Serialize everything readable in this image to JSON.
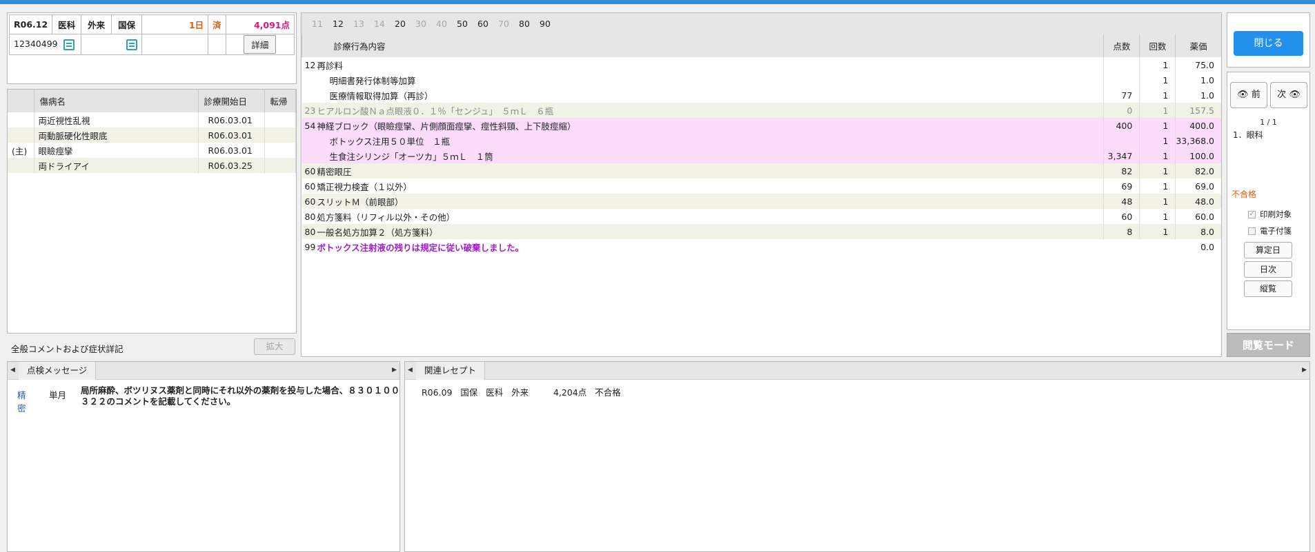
{
  "header": {
    "period": "R06.12",
    "category": "医科",
    "visit_type": "外来",
    "insurance": "国保",
    "days": "1日",
    "status": "済",
    "points": "4,091点",
    "patient_id": "12340499",
    "detail_button": "詳細"
  },
  "diseases": {
    "col_name": "傷病名",
    "col_start": "診療開始日",
    "col_outcome": "転帰",
    "rows": [
      {
        "main": "",
        "name": "両近視性乱視",
        "start": "R06.03.01"
      },
      {
        "main": "",
        "name": "両動脈硬化性眼底",
        "start": "R06.03.01"
      },
      {
        "main": "(主)",
        "name": "眼瞼痙攣",
        "start": "R06.03.01"
      },
      {
        "main": "",
        "name": "両ドライアイ",
        "start": "R06.03.25"
      }
    ]
  },
  "comment": {
    "label": "全般コメントおよび症状詳記",
    "expand_button": "拡大"
  },
  "tabs": [
    {
      "label": "11",
      "dim": true
    },
    {
      "label": "12",
      "dim": false
    },
    {
      "label": "13",
      "dim": true
    },
    {
      "label": "14",
      "dim": true
    },
    {
      "label": "20",
      "dim": false
    },
    {
      "label": "30",
      "dim": true
    },
    {
      "label": "40",
      "dim": true
    },
    {
      "label": "50",
      "dim": false
    },
    {
      "label": "60",
      "dim": false
    },
    {
      "label": "70",
      "dim": true
    },
    {
      "label": "80",
      "dim": false
    },
    {
      "label": "90",
      "dim": false
    }
  ],
  "procedures": {
    "col_name": "診療行為内容",
    "col_points": "点数",
    "col_count": "回数",
    "col_price": "薬価",
    "rows": [
      {
        "code": "12",
        "name": "再診料",
        "points": "",
        "count": "1",
        "price": "75.0",
        "style": "",
        "indent": false
      },
      {
        "code": "",
        "name": "明細書発行体制等加算",
        "points": "",
        "count": "1",
        "price": "1.0",
        "style": "",
        "indent": true
      },
      {
        "code": "",
        "name": "医療情報取得加算（再診）",
        "points": "77",
        "count": "1",
        "price": "1.0",
        "style": "",
        "indent": true
      },
      {
        "code": "23",
        "name": "ヒアルロン酸Ｎａ点眼液０．１％「センジュ」　５ｍＬ　６瓶",
        "points": "0",
        "count": "1",
        "price": "157.5",
        "style": "grey",
        "indent": false
      },
      {
        "code": "54",
        "name": "神経ブロック（眼瞼痙攣、片側顔面痙攣、痙性斜頸、上下肢痙縮）",
        "points": "400",
        "count": "1",
        "price": "400.0",
        "style": "pink",
        "indent": false
      },
      {
        "code": "",
        "name": "ボトックス注用５０単位　１瓶",
        "points": "",
        "count": "1",
        "price": "33,368.0",
        "style": "pink",
        "indent": true
      },
      {
        "code": "",
        "name": "生食注シリンジ「オーツカ」５ｍＬ　１筒",
        "points": "3,347",
        "count": "1",
        "price": "100.0",
        "style": "pink",
        "indent": true
      },
      {
        "code": "60",
        "name": "精密眼圧",
        "points": "82",
        "count": "1",
        "price": "82.0",
        "style": "alt",
        "indent": false
      },
      {
        "code": "60",
        "name": "矯正視力検査（１以外）",
        "points": "69",
        "count": "1",
        "price": "69.0",
        "style": "",
        "indent": false
      },
      {
        "code": "60",
        "name": "スリットＭ（前眼部）",
        "points": "48",
        "count": "1",
        "price": "48.0",
        "style": "alt",
        "indent": false
      },
      {
        "code": "80",
        "name": "処方箋料（リフィル以外・その他）",
        "points": "60",
        "count": "1",
        "price": "60.0",
        "style": "",
        "indent": false
      },
      {
        "code": "80",
        "name": "一般名処方加算２（処方箋料）",
        "points": "8",
        "count": "1",
        "price": "8.0",
        "style": "alt",
        "indent": false
      },
      {
        "code": "99",
        "name": "ボトックス注射液の残りは規定に従い破棄しました。",
        "points": "",
        "count": "",
        "price": "0.0",
        "style": "purple",
        "indent": false
      }
    ]
  },
  "sidebar": {
    "close_button": "閉じる",
    "prev_button": "前",
    "next_button": "次",
    "page_indicator": "1 / 1",
    "department": "1．眼科",
    "status": "不合格",
    "print_target": "印刷対象",
    "e_attach": "電子付箋",
    "calc_day_button": "算定日",
    "daily_button": "日次",
    "vertical_button": "縦覧",
    "view_mode": "閲覧モード"
  },
  "check_messages": {
    "tab": "点検メッセージ",
    "category": "精密",
    "period": "単月",
    "text": "局所麻酔、ボツリヌス薬剤と同時にそれ以外の薬剤を投与した場合、８３０１００３２２のコメントを記載してください。"
  },
  "related": {
    "tab": "関連レセプト",
    "row": "R06.09   国保   医科   外来         4,204点   不合格"
  }
}
